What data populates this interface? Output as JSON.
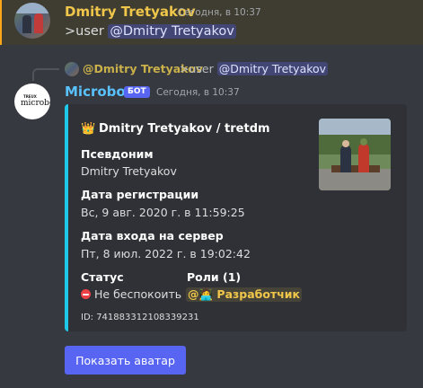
{
  "message1": {
    "author": "Dmitry Tretyakov",
    "timestamp": "Сегодня, в 10:37",
    "command": ">user",
    "mention": "@Dmitry Tretyakov"
  },
  "reply": {
    "author": "@Dmitry Tretyakov",
    "command": ">user",
    "mention": "@Dmitry Tretyakov"
  },
  "bot_message": {
    "author": "Microbot",
    "tag": "БОТ",
    "timestamp": "Сегодня, в 10:37",
    "avatar_text_small": "TREUX",
    "avatar_text_big": "microbot"
  },
  "embed": {
    "accent_color": "#1ec8e8",
    "author_icon": "crown-icon",
    "author": "Dmitry Tretyakov / tretdm",
    "fields": {
      "nickname_name": "Псевдоним",
      "nickname_value": "Dmitry Tretyakov",
      "registered_name": "Дата регистрации",
      "registered_value": "Вс, 9 авг. 2020 г. в 11:59:25",
      "joined_name": "Дата входа на сервер",
      "joined_value": "Пт, 8 июл. 2022 г. в 19:02:42",
      "status_name": "Статус",
      "status_value": "Не беспокоить",
      "roles_name": "Роли (1)",
      "role_value": "@🧑‍💻 Разработчик"
    },
    "footer": "ID: 741883312108339231"
  },
  "button": {
    "label": "Показать аватар"
  },
  "colors": {
    "background": "#36393f",
    "highlight": "#3f3c31",
    "blurple": "#5865f2",
    "username_gold": "#f0c74a",
    "bot_blue": "#59c2ff"
  }
}
